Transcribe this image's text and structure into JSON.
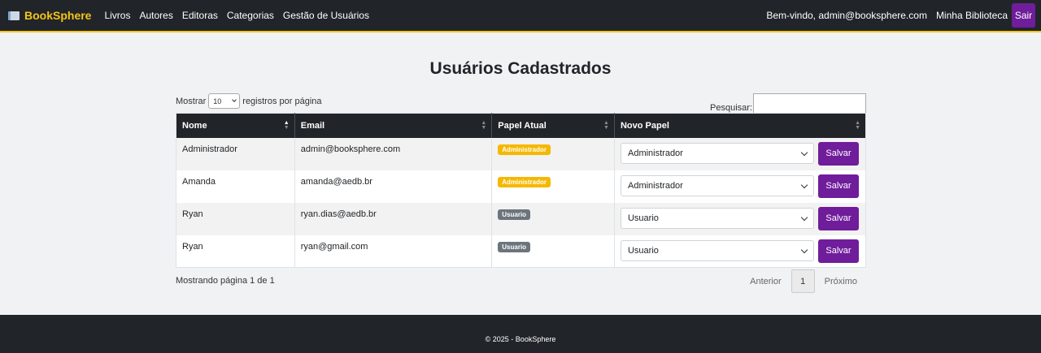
{
  "navbar": {
    "brand": "BookSphere",
    "links": [
      "Livros",
      "Autores",
      "Editoras",
      "Categorias",
      "Gestão de Usuários"
    ],
    "welcome": "Bem-vindo, admin@booksphere.com",
    "my_library": "Minha Biblioteca",
    "logout": "Sair"
  },
  "page": {
    "title": "Usuários Cadastrados"
  },
  "table_controls": {
    "show_label": "Mostrar",
    "page_length": "10",
    "per_page_label": "registros por página",
    "search_label": "Pesquisar:",
    "search_value": ""
  },
  "table": {
    "headers": [
      "Nome",
      "Email",
      "Papel Atual",
      "Novo Papel"
    ],
    "rows": [
      {
        "name": "Administrador",
        "email": "admin@booksphere.com",
        "role": "Administrador",
        "new_role": "Administrador",
        "action": "Salvar"
      },
      {
        "name": "Amanda",
        "email": "amanda@aedb.br",
        "role": "Administrador",
        "new_role": "Administrador",
        "action": "Salvar"
      },
      {
        "name": "Ryan",
        "email": "ryan.dias@aedb.br",
        "role": "Usuario",
        "new_role": "Usuario",
        "action": "Salvar"
      },
      {
        "name": "Ryan",
        "email": "ryan@gmail.com",
        "role": "Usuario",
        "new_role": "Usuario",
        "action": "Salvar"
      }
    ]
  },
  "pagination": {
    "info": "Mostrando página 1 de 1",
    "previous": "Anterior",
    "current_page": "1",
    "next": "Próximo"
  },
  "footer": {
    "text": "© 2025 - BookSphere"
  },
  "colors": {
    "navbar_bg": "#212529",
    "brand": "#f5c518",
    "primary_button": "#6f1d9b",
    "admin_badge": "#f5b800",
    "user_badge": "#6c757d"
  },
  "icons": {
    "brand": "book-icon",
    "sort": "sort-arrows-icon",
    "select": "chevron-down-icon"
  }
}
